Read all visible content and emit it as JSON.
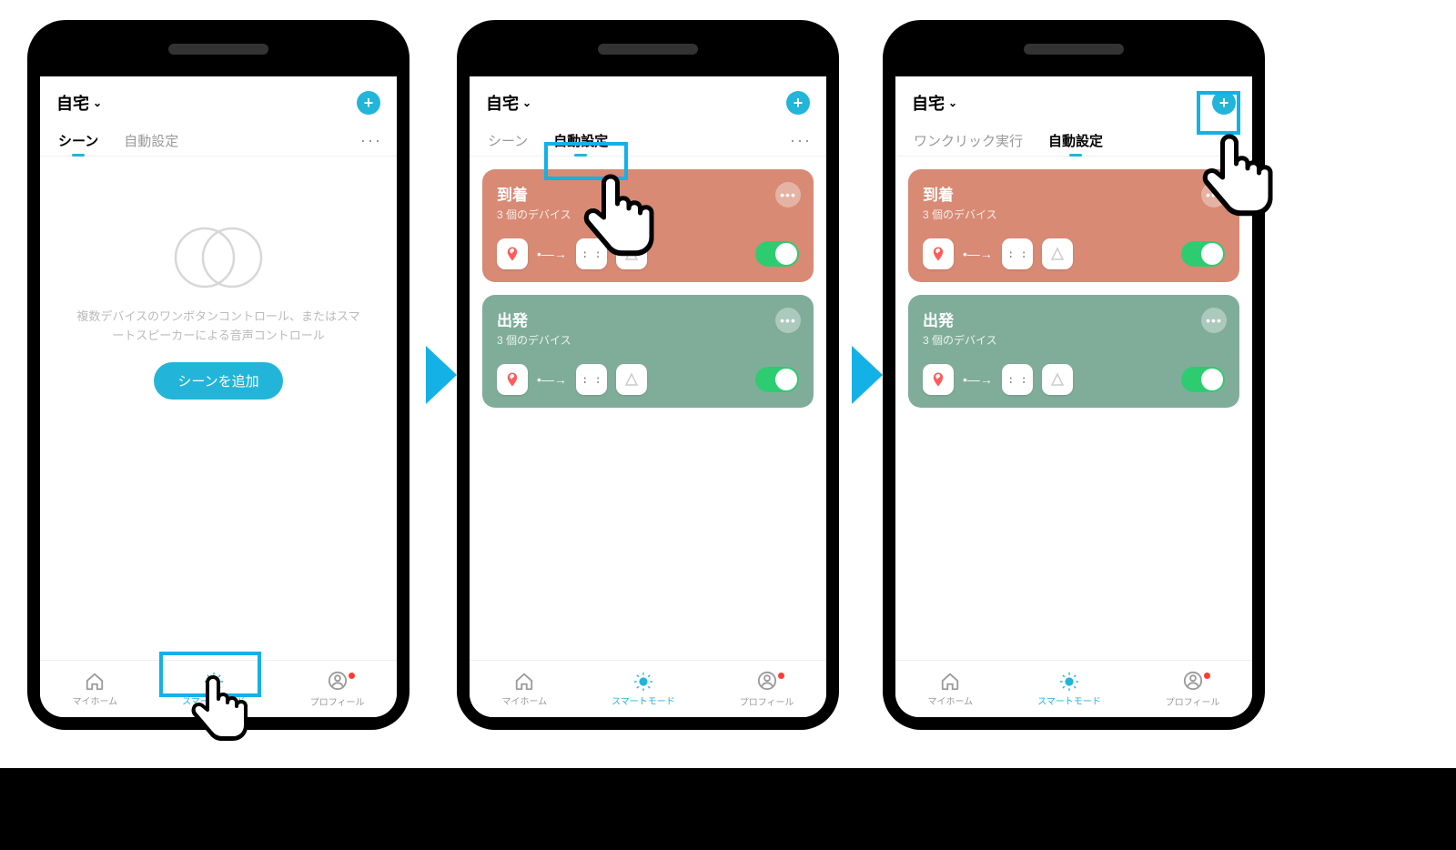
{
  "colors": {
    "accent": "#22b5d9",
    "card_arrival": "#d88a74",
    "card_departure": "#80ad9a",
    "toggle_on": "#2ecc71",
    "highlight": "#14b1e7"
  },
  "common": {
    "home_label": "自宅",
    "add_icon": "plus-icon",
    "more_label": "···",
    "tabbar": {
      "home": "マイホーム",
      "smart": "スマートモード",
      "profile": "プロフィール"
    }
  },
  "screen1": {
    "tabs": {
      "scene": "シーン",
      "auto": "自動設定"
    },
    "active_tab": "scene",
    "empty": {
      "message": "複数デバイスのワンボタンコントロール、またはスマートスピーカーによる音声コントロール",
      "button": "シーンを追加"
    }
  },
  "screen2": {
    "tabs": {
      "scene": "シーン",
      "auto": "自動設定"
    },
    "active_tab": "auto",
    "cards": [
      {
        "id": "arrival",
        "title": "到着",
        "subtitle": "3 個のデバイス",
        "toggle": true
      },
      {
        "id": "departure",
        "title": "出発",
        "subtitle": "3 個のデバイス",
        "toggle": true
      }
    ]
  },
  "screen3": {
    "tabs": {
      "oneclick": "ワンクリック実行",
      "auto": "自動設定"
    },
    "active_tab": "auto",
    "cards": [
      {
        "id": "arrival",
        "title": "到着",
        "subtitle": "3 個のデバイス",
        "toggle": true
      },
      {
        "id": "departure",
        "title": "出発",
        "subtitle": "3 個のデバイス",
        "toggle": true
      }
    ]
  }
}
